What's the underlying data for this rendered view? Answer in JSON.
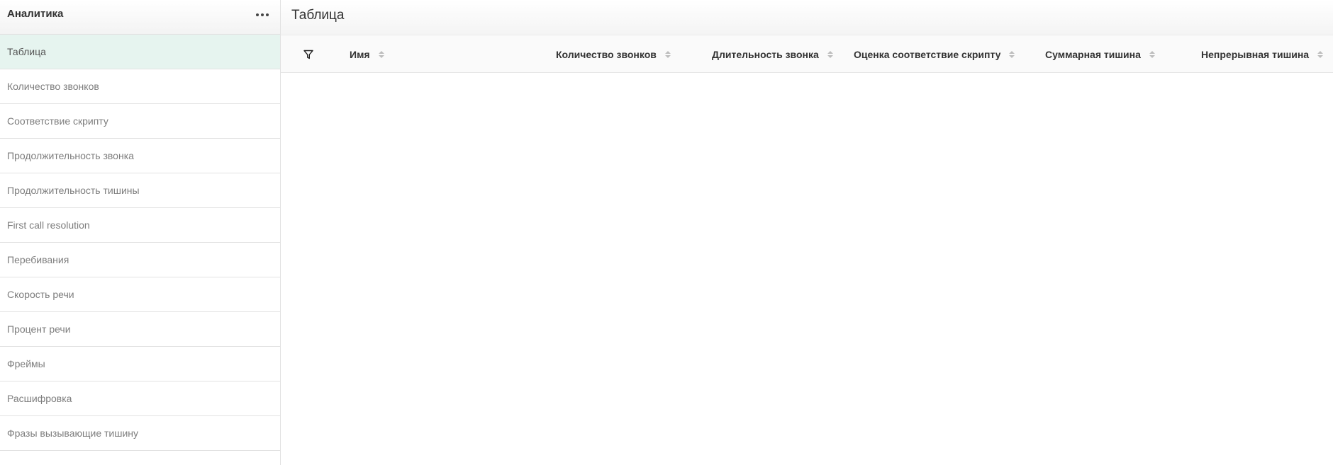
{
  "sidebar": {
    "title": "Аналитика",
    "items": [
      {
        "label": "Таблица",
        "active": true
      },
      {
        "label": "Количество звонков"
      },
      {
        "label": "Соответствие скрипту"
      },
      {
        "label": "Продолжительность звонка"
      },
      {
        "label": "Продолжительность тишины"
      },
      {
        "label": "First call resolution"
      },
      {
        "label": "Перебивания"
      },
      {
        "label": "Скорость речи"
      },
      {
        "label": "Процент речи"
      },
      {
        "label": "Фреймы"
      },
      {
        "label": "Расшифровка"
      },
      {
        "label": "Фразы вызывающие тишину"
      }
    ]
  },
  "main": {
    "title": "Таблица",
    "columns": [
      {
        "label": "Имя"
      },
      {
        "label": "Количество звонков"
      },
      {
        "label": "Длительность звонка"
      },
      {
        "label": "Оценка соответствие скрипту"
      },
      {
        "label": "Суммарная тишина"
      },
      {
        "label": "Непрерывная тишина"
      }
    ]
  },
  "colors": {
    "active_item_bg": "#e6f4ef",
    "border": "#e2e2e2"
  }
}
